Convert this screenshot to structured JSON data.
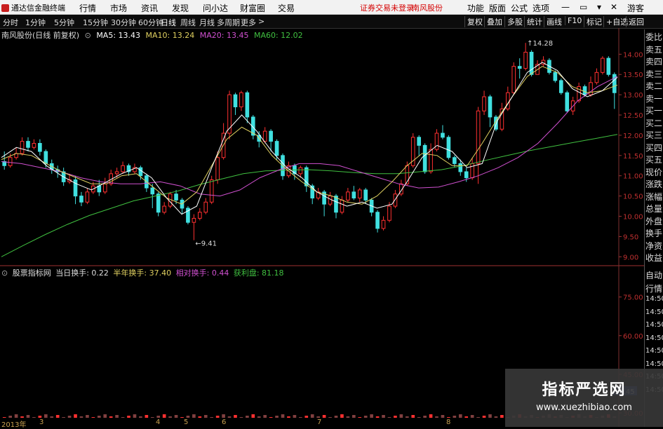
{
  "menubar": {
    "app_title": "通达信金融终端",
    "menus": [
      "行情",
      "市场",
      "资讯",
      "发现",
      "问小达",
      "财富圈",
      "交易"
    ],
    "trade_status": "证券交易未登录",
    "stock_name": "南风股份",
    "right_menus": [
      "功能",
      "版面",
      "公式",
      "选项"
    ],
    "guest": "游客"
  },
  "periodbar": {
    "periods": [
      "分时",
      "1分钟",
      "5分钟",
      "15分钟",
      "30分钟",
      "60分钟",
      "日线",
      "周线",
      "月线",
      "多周期",
      "更多"
    ],
    "active": "日线",
    "right_buttons": [
      "复权",
      "叠加",
      "多股",
      "统计",
      "画线",
      "F10",
      "标记",
      "+自选",
      "返回"
    ]
  },
  "chart_info": {
    "title": "南风股份(日线 前复权)",
    "ma5": "MA5: 13.43",
    "ma10": "MA10: 13.24",
    "ma20": "MA20: 13.45",
    "ma60": "MA60: 12.02",
    "colors": {
      "ma5": "#ffffff",
      "ma10": "#e0d060",
      "ma20": "#d050d0",
      "ma60": "#40c040",
      "up": "#ff3030",
      "down": "#40e0e0"
    }
  },
  "chart_data": [
    {
      "type": "candlestick",
      "title": "南风股份(日线 前复权)",
      "yticks": [
        9.0,
        9.5,
        10.0,
        10.5,
        11.0,
        11.5,
        12.0,
        12.5,
        13.0,
        13.5,
        14.0
      ],
      "ytick_labels": [
        "9.00",
        "9.50",
        "10.00",
        "10.50",
        "11.00",
        "11.50",
        "12.00",
        "12.50",
        "13.00",
        "13.50",
        "14.00"
      ],
      "ylim": [
        8.85,
        14.3
      ],
      "annotations": [
        {
          "text": "←9.41",
          "value": 9.41
        },
        {
          "text": "↑14.28",
          "value": 14.28
        }
      ],
      "x_labels": [
        "2013年",
        "3",
        "4",
        "5",
        "6",
        "7",
        "8"
      ],
      "candles": [
        [
          11.35,
          11.25,
          11.6,
          11.15
        ],
        [
          11.25,
          11.45,
          11.55,
          11.2
        ],
        [
          11.45,
          11.55,
          11.7,
          11.4
        ],
        [
          11.55,
          11.85,
          11.95,
          11.5
        ],
        [
          11.85,
          11.7,
          11.95,
          11.6
        ],
        [
          11.7,
          11.8,
          11.9,
          11.65
        ],
        [
          11.8,
          11.6,
          11.9,
          11.5
        ],
        [
          11.6,
          11.3,
          11.65,
          11.2
        ],
        [
          11.3,
          11.15,
          11.4,
          11.05
        ],
        [
          11.15,
          11.1,
          11.25,
          10.95
        ],
        [
          11.1,
          10.85,
          11.2,
          10.75
        ],
        [
          10.85,
          10.9,
          11.05,
          10.8
        ],
        [
          10.9,
          10.5,
          11.0,
          10.3
        ],
        [
          10.5,
          10.35,
          10.6,
          10.25
        ],
        [
          10.35,
          10.6,
          10.7,
          10.3
        ],
        [
          10.6,
          10.75,
          10.85,
          10.55
        ],
        [
          10.75,
          10.6,
          10.9,
          10.5
        ],
        [
          10.6,
          10.8,
          10.95,
          10.55
        ],
        [
          10.8,
          11.05,
          11.15,
          10.75
        ],
        [
          11.05,
          11.1,
          11.2,
          10.95
        ],
        [
          11.1,
          11.25,
          11.35,
          11.05
        ],
        [
          11.25,
          11.1,
          11.3,
          11.0
        ],
        [
          11.1,
          11.2,
          11.3,
          11.05
        ],
        [
          11.2,
          11.0,
          11.25,
          10.9
        ],
        [
          11.0,
          10.7,
          11.05,
          10.6
        ],
        [
          10.7,
          10.55,
          10.8,
          10.2
        ],
        [
          10.55,
          10.1,
          10.6,
          10.0
        ],
        [
          10.1,
          10.25,
          10.35,
          10.05
        ],
        [
          10.25,
          10.55,
          10.6,
          10.2
        ],
        [
          10.55,
          10.4,
          10.65,
          10.3
        ],
        [
          10.4,
          10.2,
          10.45,
          10.05
        ],
        [
          10.2,
          9.85,
          10.25,
          9.8
        ],
        [
          9.85,
          9.95,
          10.05,
          9.41
        ],
        [
          9.95,
          10.1,
          10.2,
          9.9
        ],
        [
          10.1,
          10.35,
          10.45,
          10.05
        ],
        [
          10.35,
          10.9,
          11.0,
          10.3
        ],
        [
          10.9,
          11.45,
          11.6,
          10.8
        ],
        [
          11.45,
          12.05,
          12.3,
          11.4
        ],
        [
          12.05,
          13.0,
          13.1,
          11.9
        ],
        [
          13.0,
          12.7,
          13.05,
          12.5
        ],
        [
          12.7,
          13.05,
          13.1,
          12.6
        ],
        [
          13.05,
          12.45,
          13.1,
          12.3
        ],
        [
          12.45,
          12.0,
          12.5,
          11.9
        ],
        [
          12.0,
          11.85,
          12.1,
          11.7
        ],
        [
          11.85,
          12.1,
          12.2,
          11.8
        ],
        [
          12.1,
          11.85,
          12.15,
          11.6
        ],
        [
          11.85,
          11.5,
          11.9,
          11.4
        ],
        [
          11.5,
          11.0,
          11.55,
          10.9
        ],
        [
          11.0,
          11.25,
          11.35,
          10.95
        ],
        [
          11.25,
          11.05,
          11.3,
          10.9
        ],
        [
          11.05,
          11.2,
          11.25,
          10.95
        ],
        [
          11.2,
          10.75,
          11.25,
          10.6
        ],
        [
          10.75,
          10.45,
          10.8,
          10.3
        ],
        [
          10.45,
          10.6,
          10.7,
          10.4
        ],
        [
          10.6,
          10.3,
          10.65,
          10.0
        ],
        [
          10.3,
          10.5,
          10.6,
          10.25
        ],
        [
          10.5,
          10.1,
          10.55,
          9.95
        ],
        [
          10.1,
          10.4,
          10.5,
          10.05
        ],
        [
          10.4,
          10.6,
          10.7,
          10.35
        ],
        [
          10.6,
          10.45,
          10.75,
          10.4
        ],
        [
          10.45,
          10.65,
          10.7,
          10.35
        ],
        [
          10.65,
          10.4,
          10.7,
          10.3
        ],
        [
          10.4,
          10.1,
          10.45,
          10.0
        ],
        [
          10.1,
          9.7,
          10.15,
          9.6
        ],
        [
          9.7,
          9.9,
          10.0,
          9.65
        ],
        [
          9.9,
          10.25,
          10.35,
          9.85
        ],
        [
          10.25,
          10.55,
          10.65,
          10.2
        ],
        [
          10.55,
          10.8,
          10.9,
          10.5
        ],
        [
          10.8,
          11.25,
          11.35,
          10.75
        ],
        [
          11.25,
          11.95,
          12.05,
          11.2
        ],
        [
          11.95,
          11.75,
          12.0,
          11.5
        ],
        [
          11.75,
          11.1,
          11.8,
          11.05
        ],
        [
          11.1,
          11.65,
          11.8,
          11.05
        ],
        [
          11.65,
          12.05,
          12.15,
          11.6
        ],
        [
          12.05,
          11.95,
          12.25,
          11.9
        ],
        [
          11.95,
          11.45,
          12.0,
          11.4
        ],
        [
          11.45,
          11.3,
          11.5,
          11.2
        ],
        [
          11.3,
          11.1,
          11.4,
          11.0
        ],
        [
          11.1,
          10.95,
          11.2,
          10.85
        ],
        [
          10.95,
          11.3,
          11.45,
          10.9
        ],
        [
          11.3,
          12.6,
          12.7,
          10.8
        ],
        [
          12.6,
          12.95,
          13.1,
          12.5
        ],
        [
          12.95,
          12.45,
          13.0,
          12.2
        ],
        [
          12.45,
          12.15,
          12.5,
          12.1
        ],
        [
          12.15,
          12.65,
          12.8,
          12.1
        ],
        [
          12.65,
          13.05,
          13.2,
          12.6
        ],
        [
          13.05,
          13.7,
          13.8,
          13.0
        ],
        [
          13.7,
          13.65,
          13.9,
          13.4
        ],
        [
          13.65,
          14.05,
          14.28,
          13.6
        ],
        [
          14.05,
          13.5,
          14.1,
          13.45
        ],
        [
          13.5,
          13.75,
          13.85,
          13.6
        ],
        [
          13.75,
          13.85,
          13.95,
          13.7
        ],
        [
          13.85,
          13.55,
          13.9,
          13.5
        ],
        [
          13.55,
          13.35,
          13.6,
          13.3
        ],
        [
          13.35,
          13.05,
          13.4,
          13.0
        ],
        [
          13.05,
          12.6,
          13.1,
          12.55
        ],
        [
          12.6,
          12.85,
          12.95,
          12.5
        ],
        [
          12.85,
          13.2,
          13.3,
          12.8
        ],
        [
          13.2,
          13.0,
          13.25,
          12.95
        ],
        [
          13.0,
          13.3,
          13.45,
          12.95
        ],
        [
          13.3,
          13.55,
          13.65,
          13.25
        ],
        [
          13.55,
          13.9,
          13.95,
          13.5
        ],
        [
          13.9,
          13.5,
          13.95,
          13.45
        ],
        [
          13.5,
          13.05,
          13.55,
          12.65
        ]
      ],
      "ma_series": [
        {
          "name": "MA60",
          "values": [
            9.0,
            9.28,
            9.55,
            9.8,
            10.02,
            10.2,
            10.38,
            10.5,
            10.62,
            10.78,
            10.92,
            11.05,
            11.12,
            11.14,
            11.15,
            11.12,
            11.08,
            11.05,
            11.05,
            11.1,
            11.15,
            11.25,
            11.38,
            11.5,
            11.62,
            11.72,
            11.82,
            11.92,
            12.02
          ]
        },
        {
          "name": "MA20",
          "values": [
            11.35,
            11.3,
            11.2,
            11.1,
            10.95,
            10.85,
            10.8,
            10.8,
            10.85,
            10.75,
            10.55,
            10.5,
            10.65,
            10.95,
            11.15,
            11.3,
            11.3,
            11.25,
            11.1,
            10.95,
            10.8,
            10.7,
            10.72,
            10.85,
            11.0,
            11.2,
            11.45,
            11.8,
            12.3,
            12.85,
            13.2,
            13.45
          ]
        },
        {
          "name": "MA10",
          "values": [
            11.4,
            11.55,
            11.5,
            11.3,
            11.1,
            10.95,
            10.8,
            10.8,
            11.0,
            11.05,
            10.75,
            10.45,
            10.3,
            10.6,
            11.25,
            11.9,
            12.2,
            12.0,
            11.5,
            11.15,
            10.85,
            10.6,
            10.5,
            10.35,
            10.3,
            10.5,
            10.85,
            11.25,
            11.55,
            11.5,
            11.25,
            11.25,
            11.8,
            12.4,
            12.95,
            13.45,
            13.7,
            13.55,
            13.2,
            13.05,
            13.1,
            13.24
          ]
        },
        {
          "name": "MA5",
          "values": [
            11.45,
            11.7,
            11.6,
            11.25,
            11.0,
            10.8,
            10.65,
            10.85,
            11.05,
            11.2,
            10.95,
            10.45,
            10.05,
            10.25,
            11.2,
            12.1,
            12.5,
            12.1,
            11.6,
            11.2,
            10.95,
            10.6,
            10.4,
            10.25,
            10.35,
            10.2,
            10.3,
            10.85,
            11.45,
            11.75,
            11.6,
            11.2,
            11.3,
            12.35,
            12.95,
            13.55,
            13.8,
            13.6,
            13.15,
            12.95,
            13.1,
            13.43
          ]
        }
      ]
    },
    {
      "type": "area",
      "title": "股票指标网",
      "yticks": [
        30.0,
        45.0,
        60.0,
        75.0
      ],
      "ytick_labels": [
        "30.00",
        "45.00",
        "60.00",
        "75.00"
      ],
      "ylim": [
        27,
        82
      ],
      "current_value": "38.45"
    }
  ],
  "indicator": {
    "name": "股票指标网",
    "today_turnover": "当日换手: 0.22",
    "half_year_turnover": "半年换手: 37.40",
    "relative_turnover": "相对换手: 0.44",
    "profit": "获利盘: 81.18"
  },
  "right_panel": {
    "labels": [
      "委比",
      "卖五",
      "卖四",
      "卖三",
      "卖二",
      "卖一",
      "买一",
      "买二",
      "买三",
      "买四",
      "买五",
      "现价",
      "涨跌",
      "涨幅",
      "总量",
      "外盘",
      "换手",
      "净资",
      "收益"
    ],
    "bottom_labels": [
      "自动",
      "行情",
      "14:50",
      "14:50",
      "14:50",
      "14:50",
      "14:50",
      "14:50",
      "14:50",
      "14:50"
    ]
  },
  "watermark": {
    "line1": "指标严选网",
    "line2": "www.xuezhibiao.com"
  }
}
